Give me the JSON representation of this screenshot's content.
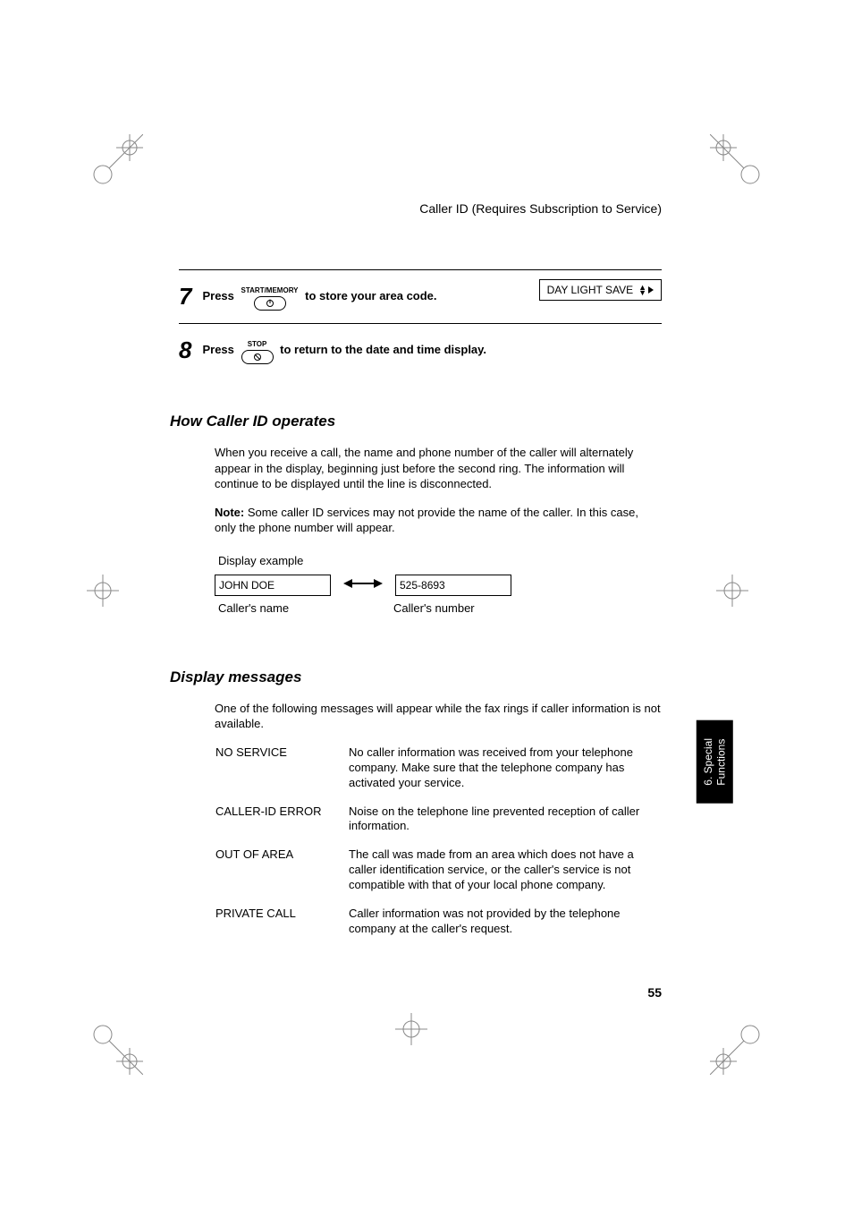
{
  "header": {
    "section_title": "Caller ID (Requires Subscription to Service)"
  },
  "steps": {
    "s7": {
      "num": "7",
      "pre": "Press ",
      "btn_label": "START/MEMORY",
      "post": " to store your area code.",
      "display": "DAY LIGHT SAVE"
    },
    "s8": {
      "num": "8",
      "pre": "Press ",
      "btn_label": "STOP",
      "post": " to return to the date and time display."
    }
  },
  "section1": {
    "heading": "How Caller ID operates",
    "para": "When you receive a call, the name and phone number of the caller will alternately appear in the display, beginning just before the second ring. The information will continue to be displayed until the line is disconnected.",
    "note_label": "Note:",
    "note_text": " Some caller ID services may not provide the name of the caller. In this case, only the phone number will appear.",
    "example_label": "Display example",
    "name_val": "JOHN DOE",
    "number_val": "525-8693",
    "name_caption": "Caller's name",
    "number_caption": "Caller's number"
  },
  "section2": {
    "heading": "Display messages",
    "intro": "One of the following messages will appear while the fax rings if caller information is not available.",
    "rows": [
      {
        "label": "NO SERVICE",
        "desc": "No caller information was received from your telephone company. Make sure that the telephone company has activated your service."
      },
      {
        "label": "CALLER-ID ERROR",
        "desc": "Noise on the telephone line prevented reception of caller information."
      },
      {
        "label": "OUT OF AREA",
        "desc": "The call was made from an area which does not have a caller identification service, or the caller's service is not compatible with that of your local phone company."
      },
      {
        "label": "PRIVATE CALL",
        "desc": "Caller information was not provided by the telephone company at the caller's request."
      }
    ]
  },
  "side_tab": "6. Special\nFunctions",
  "page_number": "55",
  "chart_data": null
}
